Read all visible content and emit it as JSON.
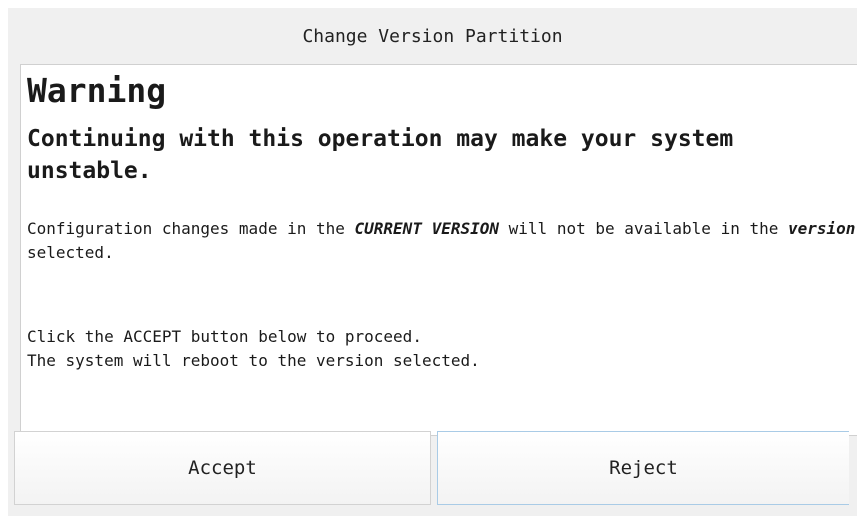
{
  "dialog": {
    "title": "Change Version Partition",
    "heading": "Warning",
    "subheading": "Continuing with this operation may make your system unstable.",
    "para1": {
      "part1": "Configuration changes made in the ",
      "current_version": "CURRENT VERSION",
      "part2": " will not be available in the ",
      "version": "version",
      "part3": " selected."
    },
    "para2": {
      "line1": "Click the ACCEPT button below to proceed.",
      "line2": "The system will reboot to the version selected."
    },
    "buttons": {
      "accept_label": "Accept",
      "reject_label": "Reject"
    }
  }
}
